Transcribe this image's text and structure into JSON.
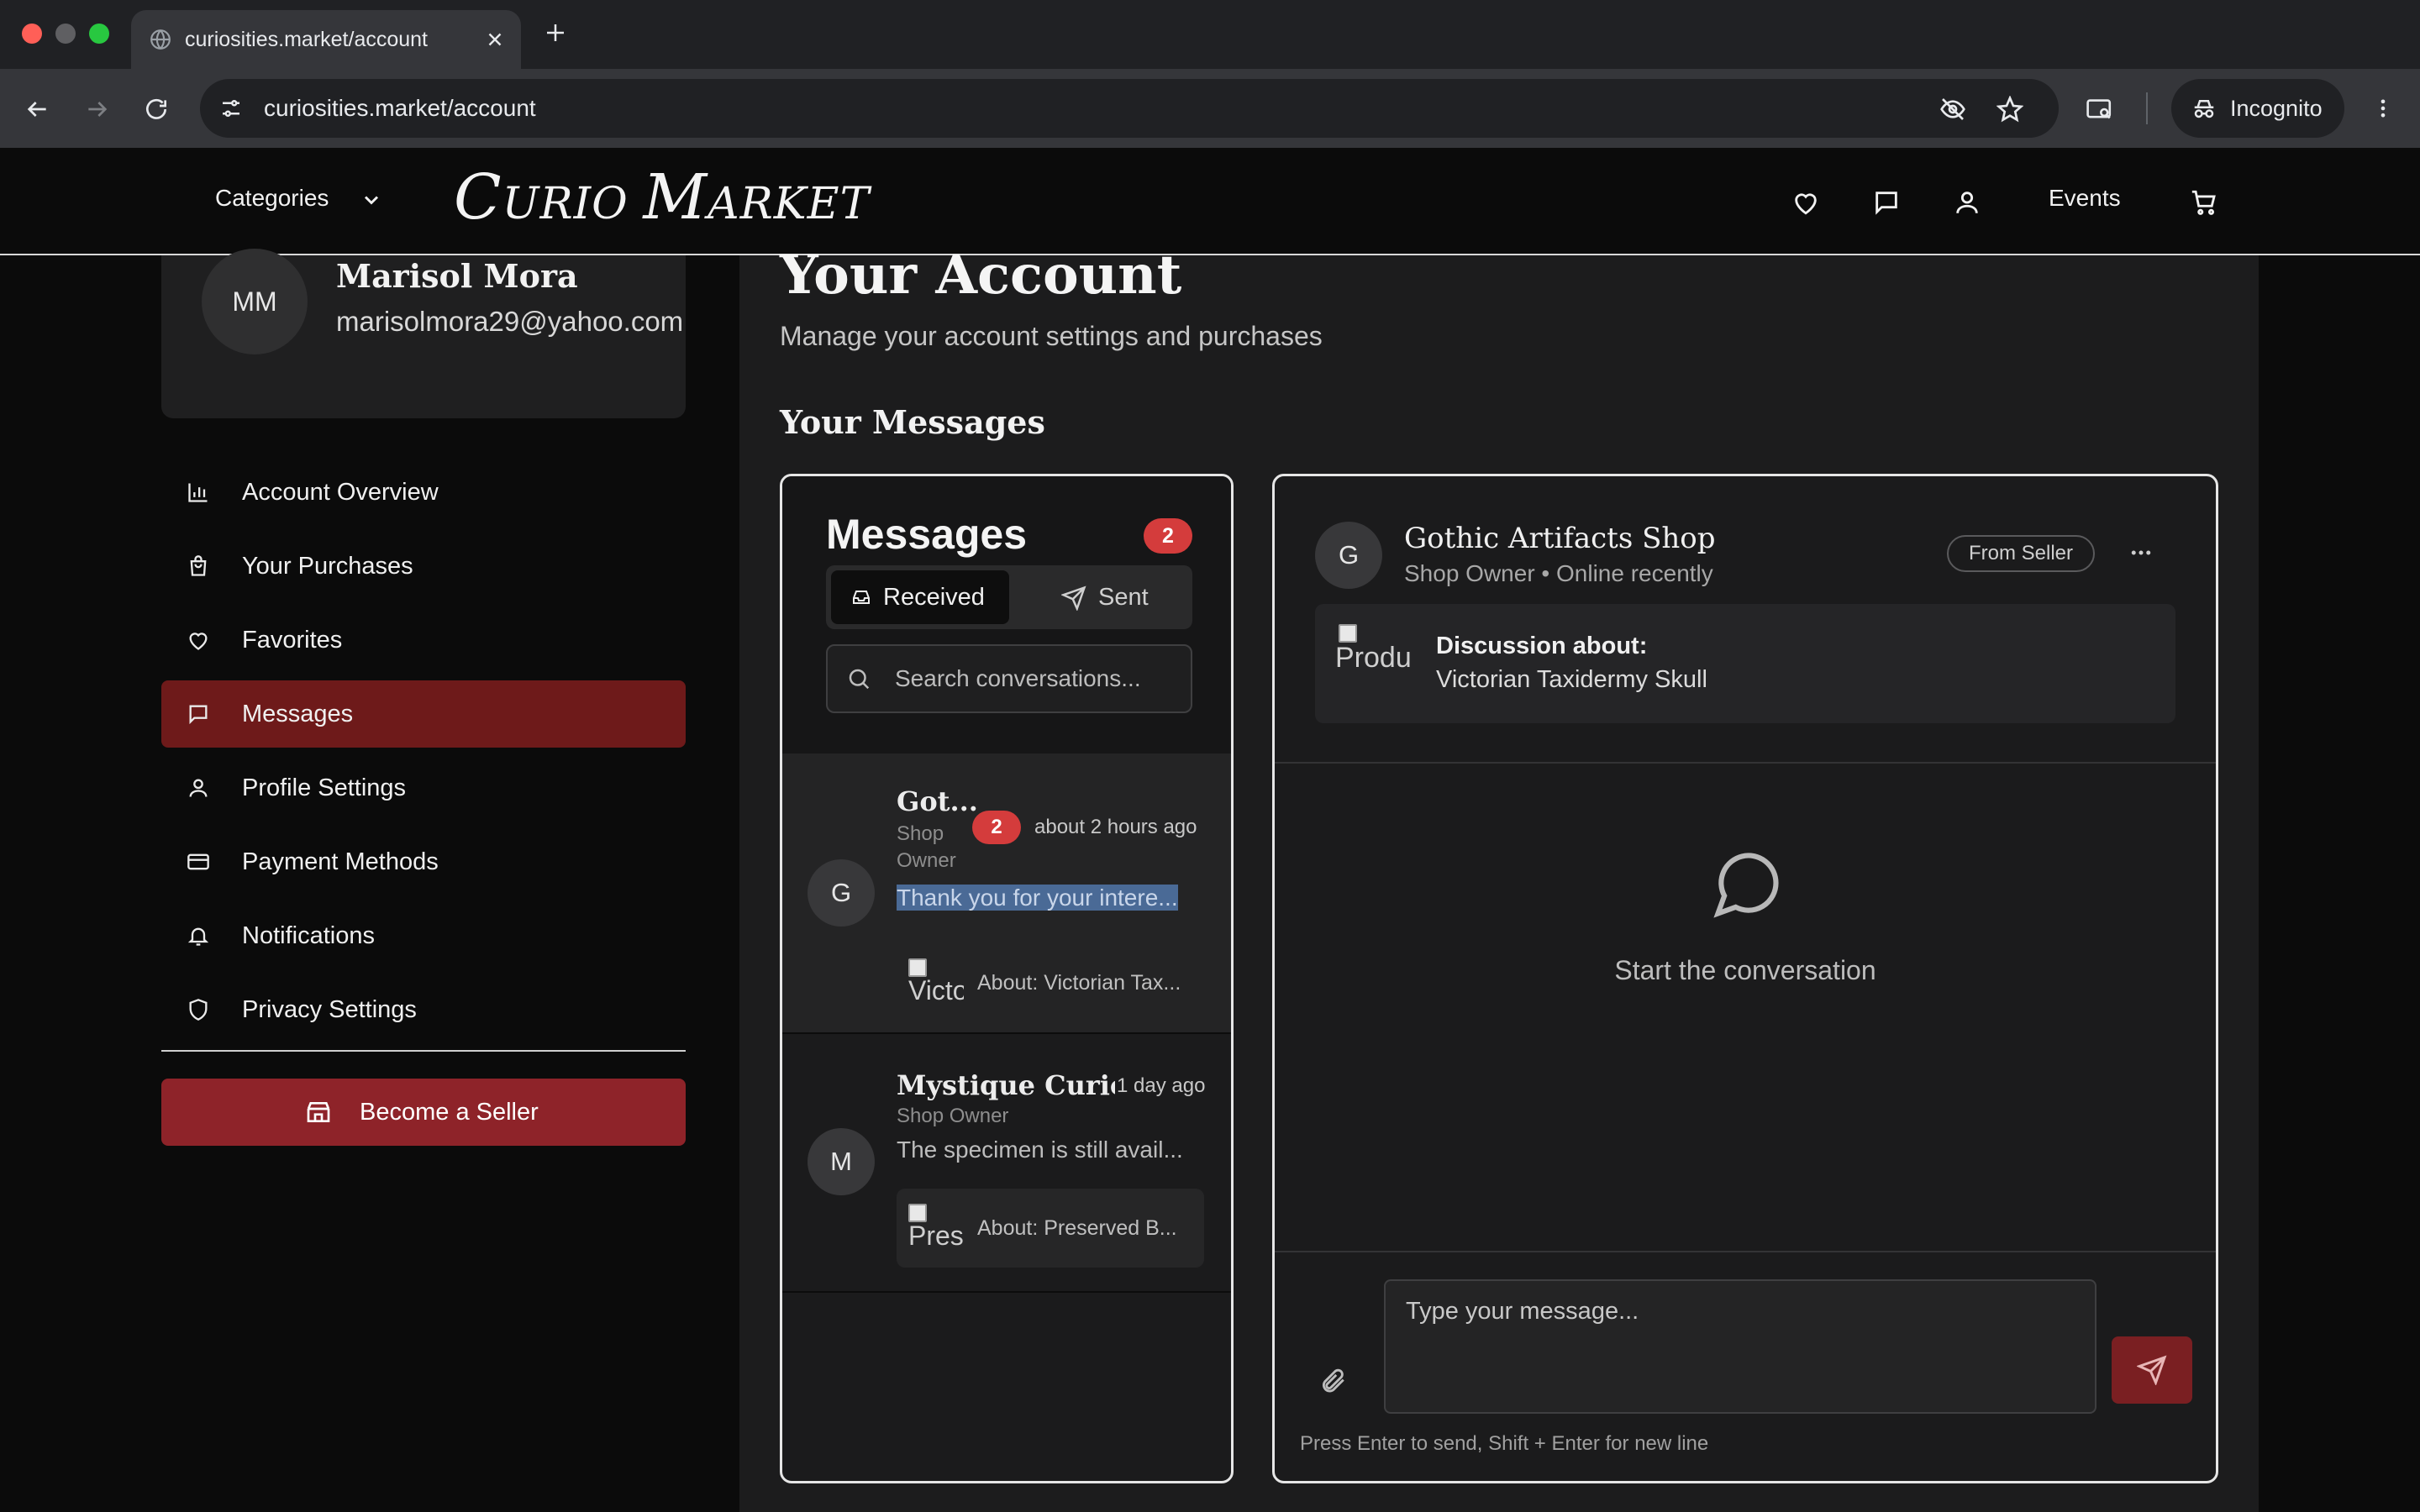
{
  "browser": {
    "tab_title": "curiosities.market/account",
    "url": "curiosities.market/account",
    "incognito_label": "Incognito"
  },
  "site": {
    "categories_label": "Categories",
    "logo": {
      "c": "C",
      "urio": "URIO ",
      "m": "M",
      "arket": "ARKET"
    },
    "events_label": "Events"
  },
  "profile": {
    "initials": "MM",
    "name": "Marisol Mora",
    "email": "marisolmora29@yahoo.com"
  },
  "sidebar": {
    "items": [
      {
        "label": "Account Overview",
        "icon": "bar-chart-icon"
      },
      {
        "label": "Your Purchases",
        "icon": "shopping-bag-icon"
      },
      {
        "label": "Favorites",
        "icon": "heart-icon"
      },
      {
        "label": "Messages",
        "icon": "message-square-icon",
        "active": true
      },
      {
        "label": "Profile Settings",
        "icon": "user-icon"
      },
      {
        "label": "Payment Methods",
        "icon": "credit-card-icon"
      },
      {
        "label": "Notifications",
        "icon": "bell-icon"
      },
      {
        "label": "Privacy Settings",
        "icon": "shield-icon"
      }
    ],
    "become_seller_label": "Become a Seller"
  },
  "page": {
    "title": "Your Account",
    "subtitle": "Manage your account settings and purchases",
    "messages_heading": "Your Messages"
  },
  "messages_list": {
    "title": "Messages",
    "unread_count": "2",
    "tabs": {
      "received": "Received",
      "sent": "Sent"
    },
    "search_placeholder": "Search conversations...",
    "conversations": [
      {
        "avatar": "G",
        "name": "Got...",
        "role_line1": "Shop",
        "role_line2": "Owner",
        "unread": "2",
        "time": "about 2 hours ago",
        "preview": "Thank you for your intere...",
        "thumb_alt": "Victo",
        "about": "About: Victorian Tax..."
      },
      {
        "avatar": "M",
        "name": "Mystique Curio...",
        "role": "Shop Owner",
        "time": "1 day ago",
        "preview": "The specimen is still avail...",
        "thumb_alt": "Pres",
        "about": "About: Preserved B..."
      }
    ]
  },
  "chat": {
    "avatar": "G",
    "shop_name": "Gothic Artifacts Shop",
    "status": "Shop Owner • Online recently",
    "badge": "From Seller",
    "discussion_title": "Discussion about:",
    "discussion_item": "Victorian Taxidermy Skull",
    "thumb_alt": "Produ",
    "empty_text": "Start the conversation",
    "input_placeholder": "Type your message...",
    "hint": "Press Enter to send, Shift + Enter for new line"
  },
  "colors": {
    "accent": "#8e2329",
    "active_nav": "#6e1a1a",
    "badge": "#d43c3c",
    "selection": "#4a6a96"
  }
}
